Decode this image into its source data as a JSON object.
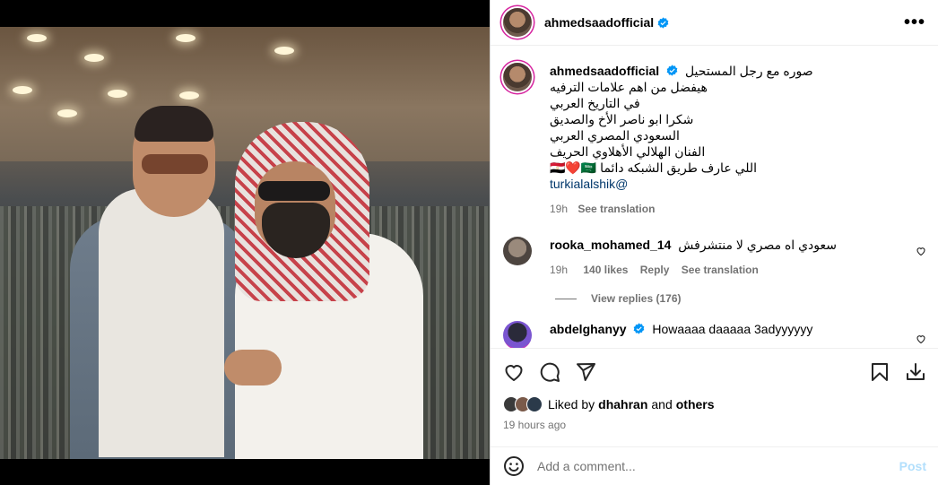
{
  "post": {
    "author": "ahmedsaadofficial",
    "more_icon": "more-horizontal-icon",
    "verified_color": "#0095f6"
  },
  "caption": {
    "author": "ahmedsaadofficial",
    "lines": [
      "صوره مع رجل المستحيل",
      "هيفضل من اهم علامات الترفيه",
      "في التاريخ العربي",
      "شكرا ابو ناصر الأخ والصديق",
      "السعودي المصري العربي",
      "الفنان الهلالي الأهلاوي الحريف",
      "اللي عارف طريق الشبكه دائما 🇪🇬❤️🇸🇦"
    ],
    "mention": "turkialalshik@",
    "time": "19h",
    "see_translation": "See translation"
  },
  "comments": [
    {
      "user": "rooka_mohamed_14",
      "text": "سعودي اه مصري لا منتشرفش",
      "time": "19h",
      "likes": "140 likes",
      "reply": "Reply",
      "see_translation": "See translation",
      "view_replies": "View replies (176)"
    },
    {
      "user": "abdelghanyy",
      "text": "Howaaaa daaaaa 3adyyyyyy"
    }
  ],
  "actions": {
    "icons": [
      "heart-icon",
      "comment-icon",
      "share-icon",
      "bookmark-icon",
      "download-icon"
    ]
  },
  "likes": {
    "prefix": "Liked by",
    "user": "dhahran",
    "connector": "and",
    "others": "others"
  },
  "timestamp": "19 hours ago",
  "add_comment": {
    "placeholder": "Add a comment...",
    "post_label": "Post",
    "post_color": "#b2dffc"
  }
}
